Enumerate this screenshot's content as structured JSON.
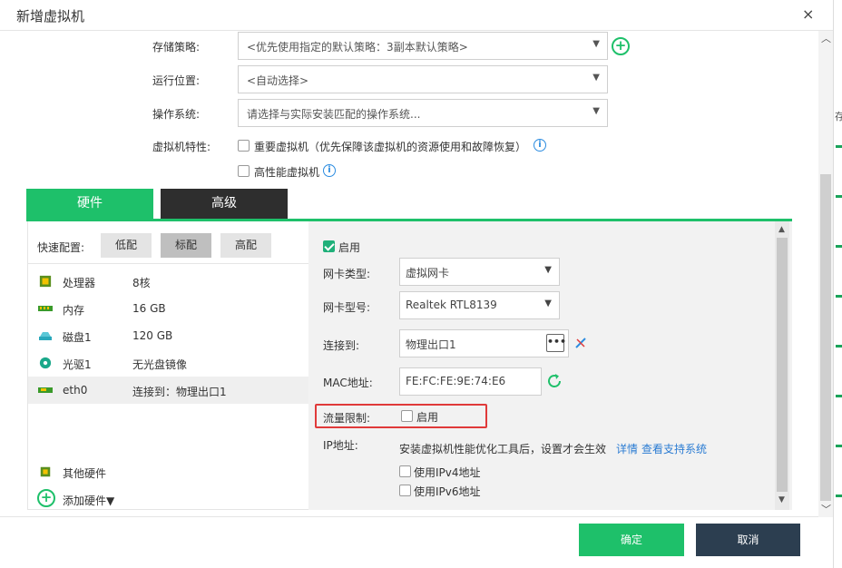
{
  "dialog": {
    "title": "新增虚拟机",
    "close_symbol": "×"
  },
  "backdrop": {
    "text": "存"
  },
  "form": {
    "storage_policy": {
      "label": "存储策略:",
      "value": "<优先使用指定的默认策略：3副本默认策略>"
    },
    "run_location": {
      "label": "运行位置:",
      "value": "<自动选择>"
    },
    "os": {
      "label": "操作系统:",
      "value": "请选择与实际安装匹配的操作系统..."
    },
    "vm_features": {
      "label": "虚拟机特性:",
      "important_vm": "重要虚拟机（优先保障该虚拟机的资源使用和故障恢复）",
      "high_perf_vm": "高性能虚拟机"
    }
  },
  "tabs": [
    {
      "label": "硬件"
    },
    {
      "label": "高级"
    }
  ],
  "hardware": {
    "quick_config_label": "快速配置:",
    "quick_buttons": [
      "低配",
      "标配",
      "高配"
    ],
    "items": [
      {
        "name": "处理器",
        "value": "8核",
        "icon": "cpu-icon"
      },
      {
        "name": "内存",
        "value": "16 GB",
        "icon": "memory-icon"
      },
      {
        "name": "磁盘1",
        "value": "120 GB",
        "icon": "disk-icon"
      },
      {
        "name": "光驱1",
        "value": "无光盘镜像",
        "icon": "cdrom-icon"
      },
      {
        "name": "eth0",
        "value": "连接到：物理出口1",
        "icon": "nic-icon"
      }
    ],
    "other_hardware": "其他硬件",
    "add_hardware": "添加硬件▼"
  },
  "nic": {
    "enable_label": "启用",
    "enabled": true,
    "nic_type_label": "网卡类型:",
    "nic_type_value": "虚拟网卡",
    "nic_model_label": "网卡型号:",
    "nic_model_value": "Realtek RTL8139",
    "connect_label": "连接到:",
    "connect_value": "物理出口1",
    "mac_label": "MAC地址:",
    "mac_value": "FE:FC:FE:9E:74:E6",
    "traffic_limit_label": "流量限制:",
    "traffic_limit_enable": "启用",
    "ip_label": "IP地址:",
    "ip_note": "安装虚拟机性能优化工具后，设置才会生效",
    "details_link": "详情",
    "supported_link": "查看支持系统",
    "ipv4_label": "使用IPv4地址",
    "ipv6_label": "使用IPv6地址"
  },
  "footer": {
    "ok_label": "确定",
    "cancel_label": "取消"
  },
  "colors": {
    "accent_green": "#1ec06a",
    "dark_tab": "#2e2e2e",
    "cancel_button": "#2c3e50",
    "link_blue": "#2b7cd3",
    "highlight_red": "#e03a3a"
  }
}
